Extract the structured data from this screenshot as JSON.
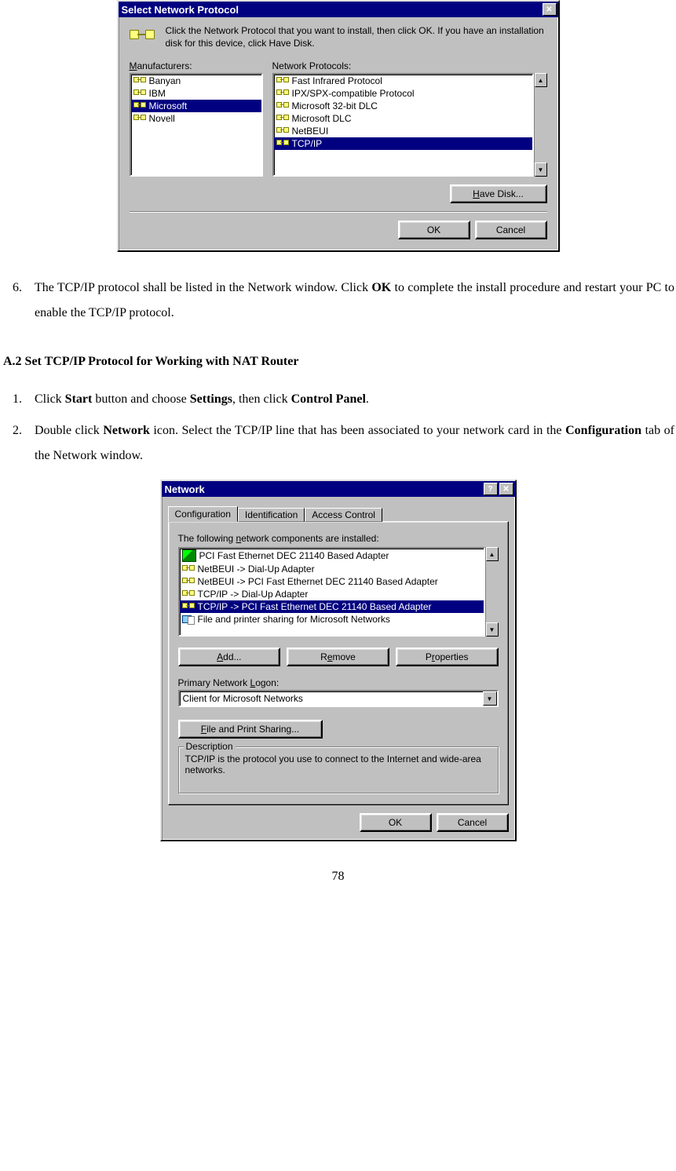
{
  "dialog1": {
    "title": "Select Network Protocol",
    "instruction": "Click the Network Protocol that you want to install, then click OK. If you have an installation disk for this device, click Have Disk.",
    "manufacturers_label": "Manufacturers:",
    "protocols_label": "Network Protocols:",
    "manufacturers": [
      "Banyan",
      "IBM",
      "Microsoft",
      "Novell"
    ],
    "manufacturers_selected": 2,
    "protocols": [
      "Fast Infrared Protocol",
      "IPX/SPX-compatible Protocol",
      "Microsoft 32-bit DLC",
      "Microsoft DLC",
      "NetBEUI",
      "TCP/IP"
    ],
    "protocols_selected": 5,
    "have_disk": "Have Disk...",
    "ok": "OK",
    "cancel": "Cancel"
  },
  "doc": {
    "step6_num": "6.",
    "step6_a": "The TCP/IP protocol shall be listed in the Network window. Click ",
    "step6_b": "OK",
    "step6_c": " to complete the install procedure and restart your PC to enable the TCP/IP protocol.",
    "heading": "A.2 Set TCP/IP Protocol for Working with NAT Router",
    "s1_num": "1.",
    "s1_a": "Click ",
    "s1_b": "Start",
    "s1_c": " button and choose ",
    "s1_d": "Settings",
    "s1_e": ", then click ",
    "s1_f": "Control Panel",
    "s1_g": ".",
    "s2_num": "2.",
    "s2_a": "Double click ",
    "s2_b": "Network",
    "s2_c": " icon. Select the TCP/IP line that has been associated to your network card in the ",
    "s2_d": "Configuration",
    "s2_e": " tab of the Network window.",
    "page": "78"
  },
  "dialog2": {
    "title": "Network",
    "tabs": [
      "Configuration",
      "Identification",
      "Access Control"
    ],
    "active_tab": 0,
    "list_label": "The following network components are installed:",
    "components": [
      {
        "icon": "adapter",
        "text": "PCI Fast Ethernet DEC 21140 Based Adapter"
      },
      {
        "icon": "proto",
        "text": "NetBEUI -> Dial-Up Adapter"
      },
      {
        "icon": "proto",
        "text": "NetBEUI -> PCI Fast Ethernet DEC 21140 Based Adapter"
      },
      {
        "icon": "proto",
        "text": "TCP/IP -> Dial-Up Adapter"
      },
      {
        "icon": "proto",
        "text": "TCP/IP -> PCI Fast Ethernet DEC 21140 Based Adapter"
      },
      {
        "icon": "share",
        "text": "File and printer sharing for Microsoft Networks"
      }
    ],
    "selected": 4,
    "add": "Add...",
    "remove": "Remove",
    "properties": "Properties",
    "logon_label": "Primary Network Logon:",
    "logon_value": "Client for Microsoft Networks",
    "fps": "File and Print Sharing...",
    "desc_label": "Description",
    "desc_text": "TCP/IP is the protocol you use to connect to the Internet and wide-area networks.",
    "ok": "OK",
    "cancel": "Cancel"
  }
}
